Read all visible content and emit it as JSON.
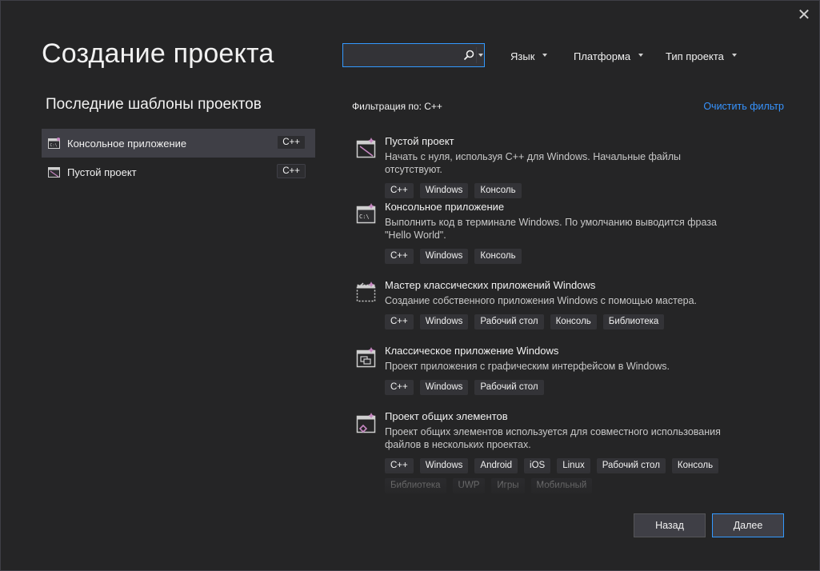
{
  "window": {
    "close_glyph": "✕"
  },
  "page_title": "Создание проекта",
  "recent": {
    "title": "Последние шаблоны проектов",
    "items": [
      {
        "label": "Консольное приложение",
        "lang": "C++",
        "icon": "console-app-icon",
        "selected": true
      },
      {
        "label": "Пустой проект",
        "lang": "C++",
        "icon": "empty-project-icon",
        "selected": false
      }
    ]
  },
  "search": {
    "value": "",
    "placeholder": ""
  },
  "filters": {
    "language": "Язык",
    "platform": "Платформа",
    "project_type": "Тип проекта"
  },
  "filter_line": "Фильтрация по: C++",
  "clear_filter": "Очистить фильтр",
  "templates": [
    {
      "title": "Пустой проект",
      "desc": "Начать с нуля, используя C++ для Windows. Начальные файлы отсутствуют.",
      "tags": [
        "C++",
        "Windows",
        "Консоль"
      ],
      "icon": "empty-project-icon"
    },
    {
      "title": "Консольное приложение",
      "desc": "Выполнить код в терминале Windows. По умолчанию выводится фраза \"Hello World\".",
      "tags": [
        "C++",
        "Windows",
        "Консоль"
      ],
      "icon": "console-app-icon"
    },
    {
      "title": "Мастер классических приложений Windows",
      "desc": "Создание собственного приложения Windows с помощью мастера.",
      "tags": [
        "C++",
        "Windows",
        "Рабочий стол",
        "Консоль",
        "Библиотека"
      ],
      "icon": "wizard-icon"
    },
    {
      "title": "Классическое приложение Windows",
      "desc": "Проект приложения с графическим интерфейсом в Windows.",
      "tags": [
        "C++",
        "Windows",
        "Рабочий стол"
      ],
      "icon": "desktop-app-icon"
    },
    {
      "title": "Проект общих элементов",
      "desc": "Проект общих элементов используется для совместного использования файлов в нескольких проектах.",
      "tags": [
        "C++",
        "Windows",
        "Android",
        "iOS",
        "Linux",
        "Рабочий стол",
        "Консоль",
        "Библиотека",
        "UWP",
        "Игры",
        "Мобильный"
      ],
      "icon": "shared-items-icon"
    }
  ],
  "buttons": {
    "back": "Назад",
    "next": "Далее"
  },
  "colors": {
    "accent": "#3399ff",
    "link": "#3794ff",
    "background": "#252526",
    "tag_bg": "#333337",
    "template_icon_accent": "#c586c0"
  }
}
